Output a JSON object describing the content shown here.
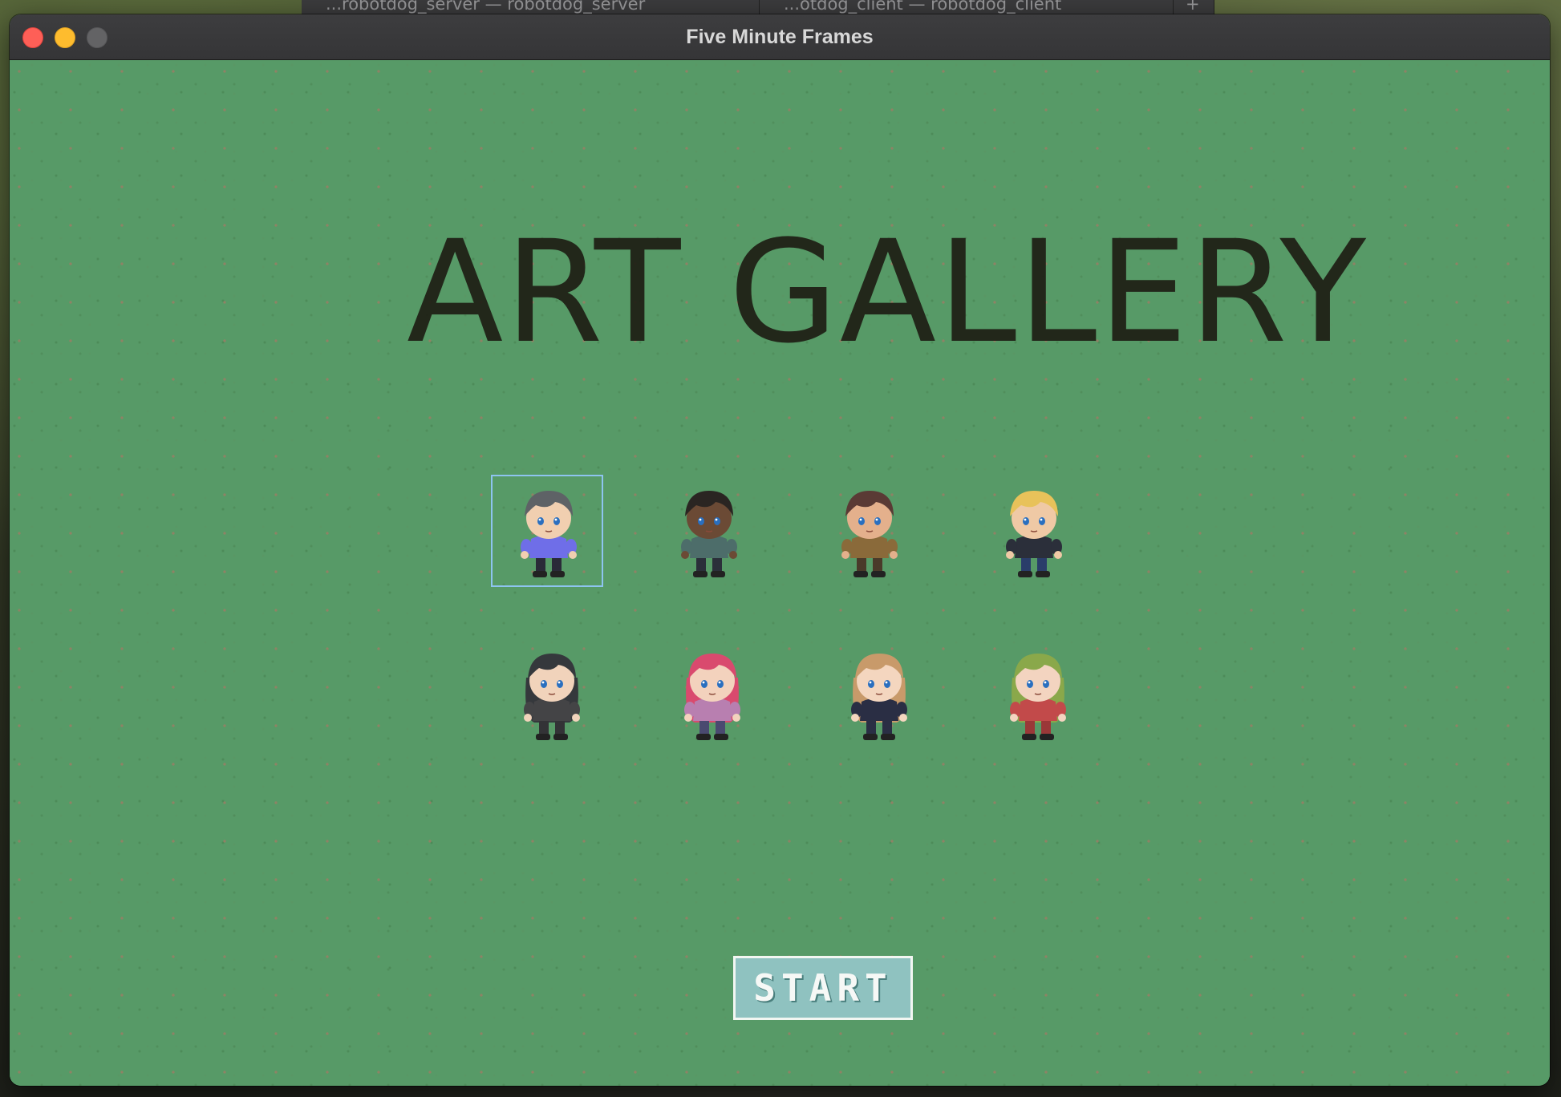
{
  "background_tabs": [
    {
      "label": "...robotdog_server — robotdog_server"
    },
    {
      "label": "...otdog_client — robotdog_client"
    },
    {
      "label": "+"
    }
  ],
  "window": {
    "title": "Five Minute Frames"
  },
  "game": {
    "title": "ART GALLERY",
    "start_label": "START",
    "selected_index": 0,
    "characters": [
      {
        "name": "gray-hair-boy-icon",
        "hair": "#5e6266",
        "skin": "#f1cfb0",
        "shirt": "#6f6ee8",
        "pants": "#2a2a38"
      },
      {
        "name": "dark-skin-man-icon",
        "hair": "#2a2522",
        "skin": "#6b4a35",
        "shirt": "#4d6d6a",
        "pants": "#2b2f3a"
      },
      {
        "name": "brown-spiky-hair-warrior-icon",
        "hair": "#5a3a35",
        "skin": "#e4b08c",
        "shirt": "#8a6a3a",
        "pants": "#4a3a2a"
      },
      {
        "name": "blonde-bearded-man-icon",
        "hair": "#e8c25a",
        "skin": "#efc9a5",
        "shirt": "#2b2f3a",
        "pants": "#2a3d6a"
      },
      {
        "name": "dark-hair-girl-icon",
        "hair": "#35383c",
        "skin": "#f1d3bb",
        "shirt": "#444446",
        "pants": "#333336"
      },
      {
        "name": "pink-hair-girl-icon",
        "hair": "#d94a6e",
        "skin": "#f3d2bd",
        "shirt": "#b87fb0",
        "pants": "#4a4a70"
      },
      {
        "name": "blonde-long-hair-woman-icon",
        "hair": "#c89a6a",
        "skin": "#f4d6bf",
        "shirt": "#2a2e44",
        "pants": "#2a2e44"
      },
      {
        "name": "green-hair-knight-icon",
        "hair": "#8aa84a",
        "skin": "#f3d4c0",
        "shirt": "#c24a4a",
        "pants": "#9a3838"
      }
    ]
  }
}
